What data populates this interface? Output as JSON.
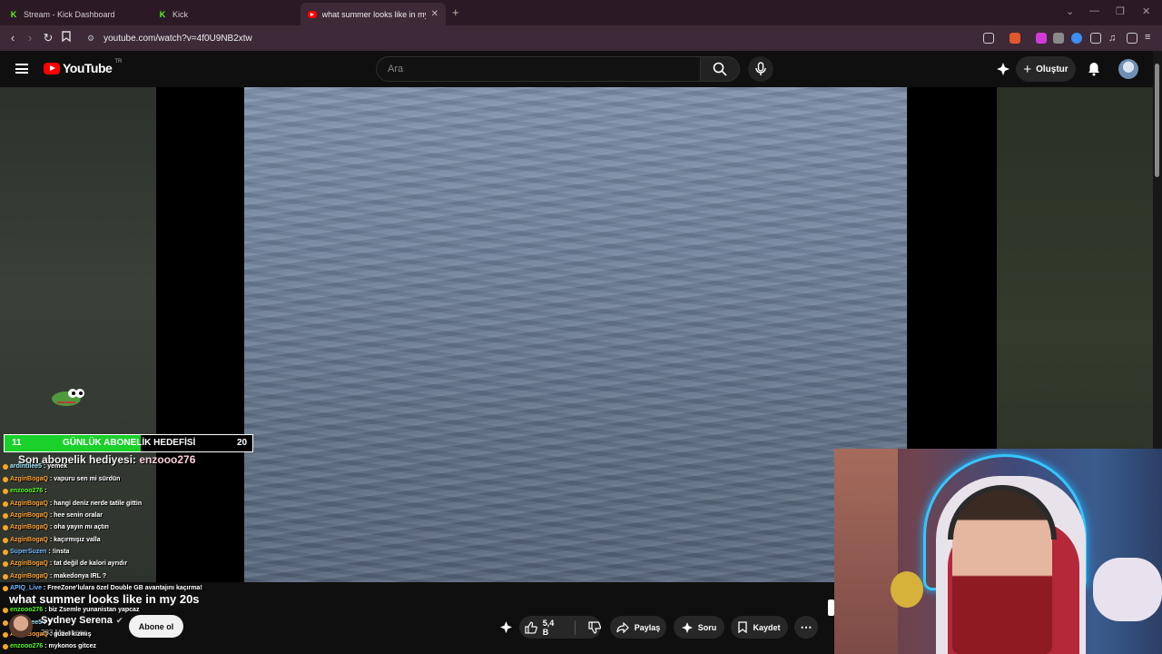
{
  "browser": {
    "tabs": [
      {
        "label": "Stream - Kick Dashboard",
        "icon": "kick-icon"
      },
      {
        "label": "Kick",
        "icon": "kick-icon"
      },
      {
        "label": "what summer looks like in my 20",
        "icon": "youtube-icon",
        "active": true
      }
    ],
    "url": "youtube.com/watch?v=4f0U9NB2xtw"
  },
  "youtube": {
    "logo_text": "YouTube",
    "country_code": "TR",
    "search_placeholder": "Ara",
    "create_label": "Oluştur"
  },
  "overlay": {
    "goal": {
      "current": "11",
      "label": "GÜNLÜK ABONELİK HEDEFİSİ",
      "target": "20",
      "progress": 0.55
    },
    "last_gift_prefix": "Son abonelik hediyesi:",
    "last_gift_user": "enzooo276"
  },
  "chat": [
    {
      "user": "ardintilee5",
      "color": "#a0e6ff",
      "text": ": yemek"
    },
    {
      "user": "AzginBogaQ",
      "color": "#ff9f2e",
      "text": ": vapuru sen mi sürdün"
    },
    {
      "user": "enzooo276",
      "color": "#53fc18",
      "text": ":"
    },
    {
      "user": "AzginBogaQ",
      "color": "#ff9f2e",
      "text": ": hangi deniz nerde tatile gittin"
    },
    {
      "user": "AzginBogaQ",
      "color": "#ff9f2e",
      "text": ": hee senin oralar"
    },
    {
      "user": "AzginBogaQ",
      "color": "#ff9f2e",
      "text": ": oha yayın mı açtın"
    },
    {
      "user": "AzginBogaQ",
      "color": "#ff9f2e",
      "text": ": kaçırmışız valla"
    },
    {
      "user": "SuperSuzen",
      "color": "#6fb7ff",
      "text": ": !insta"
    },
    {
      "user": "AzginBogaQ",
      "color": "#ff9f2e",
      "text": ": tat değil de kalori ayrıdır"
    },
    {
      "user": "AzginBogaQ",
      "color": "#ff9f2e",
      "text": ": makedonya IRL ?"
    },
    {
      "user": "APIQ_Live",
      "color": "#6fb7ff",
      "text": ": FreeZone'lulara özel Double GB avantajını kaçırma!"
    },
    {
      "user": "enzooo276",
      "color": "#53fc18",
      "text": ": biz Zsemle yunanistan yapcaz"
    },
    {
      "user": "ardintilee5",
      "color": "#a0e6ff",
      "text": ": ?"
    },
    {
      "user": "AzginBogaQ",
      "color": "#ff9f2e",
      "text": ": güzel kızmış"
    },
    {
      "user": "enzooo276",
      "color": "#53fc18",
      "text": ": mykonos gitcez"
    }
  ],
  "video": {
    "title": "what summer looks like in my 20s",
    "channel": "Sydney Serena",
    "subscribers": "283 Mn abone",
    "subscribe_label": "Abone ol",
    "likes": "5,4 B",
    "share_label": "Paylaş",
    "ask_label": "Soru",
    "save_label": "Kaydet"
  },
  "colors": {
    "youtube_red": "#ff0000",
    "kick_green": "#53fc18",
    "goal_green": "#19d12a"
  }
}
